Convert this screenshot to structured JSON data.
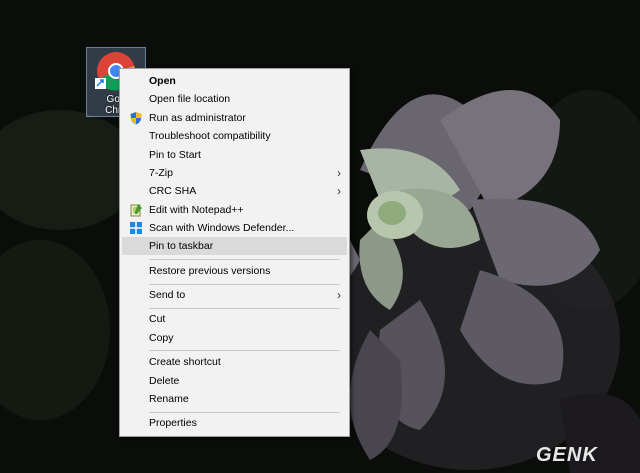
{
  "desktop": {
    "icon_label_line1": "Goo",
    "icon_label_line2": "Chro"
  },
  "context_menu": {
    "open": "Open",
    "open_file_location": "Open file location",
    "run_as_admin": "Run as administrator",
    "troubleshoot": "Troubleshoot compatibility",
    "pin_to_start": "Pin to Start",
    "seven_zip": "7-Zip",
    "crc_sha": "CRC SHA",
    "edit_notepad": "Edit with Notepad++",
    "scan_defender": "Scan with Windows Defender...",
    "pin_taskbar": "Pin to taskbar",
    "restore_versions": "Restore previous versions",
    "send_to": "Send to",
    "cut": "Cut",
    "copy": "Copy",
    "create_shortcut": "Create shortcut",
    "delete": "Delete",
    "rename": "Rename",
    "properties": "Properties",
    "submenu_arrow": "›",
    "highlight_color": "#dadada"
  },
  "watermark": "GENK"
}
